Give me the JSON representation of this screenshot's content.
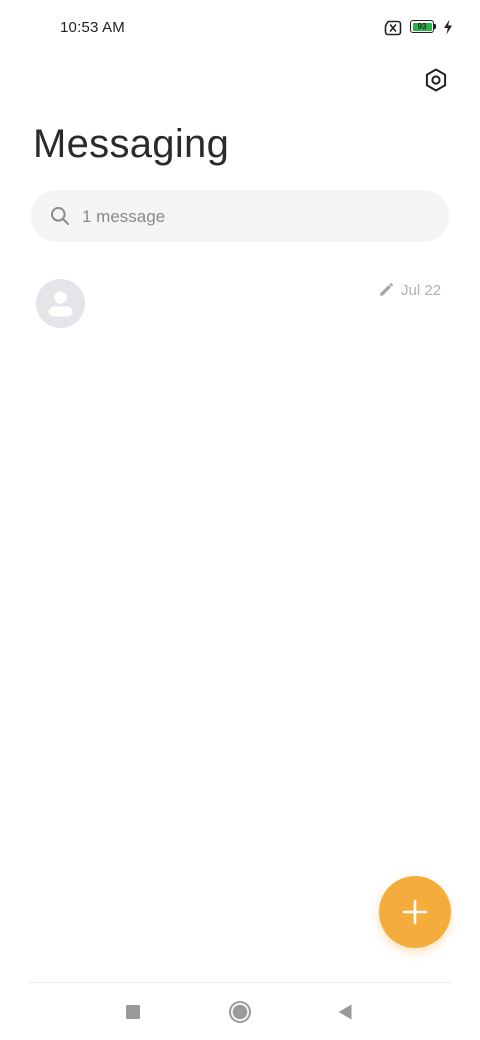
{
  "status_bar": {
    "time": "10:53 AM",
    "battery_level": "93",
    "battery_color": "#2bb34a",
    "icons": [
      "no-sim-icon",
      "battery-icon",
      "charging-bolt-icon"
    ]
  },
  "header": {
    "settings_icon": "settings-hexagon-icon",
    "title": "Messaging"
  },
  "search": {
    "icon": "search-icon",
    "placeholder": "1 message"
  },
  "conversations": [
    {
      "avatar": "default-contact-avatar-icon",
      "status_icon": "draft-pencil-icon",
      "date": "Jul 22"
    }
  ],
  "fab": {
    "icon": "plus-icon",
    "color": "#f4ac3c"
  },
  "navigation_bar": {
    "buttons": [
      "recents-square-icon",
      "home-circle-icon",
      "back-triangle-icon"
    ]
  }
}
